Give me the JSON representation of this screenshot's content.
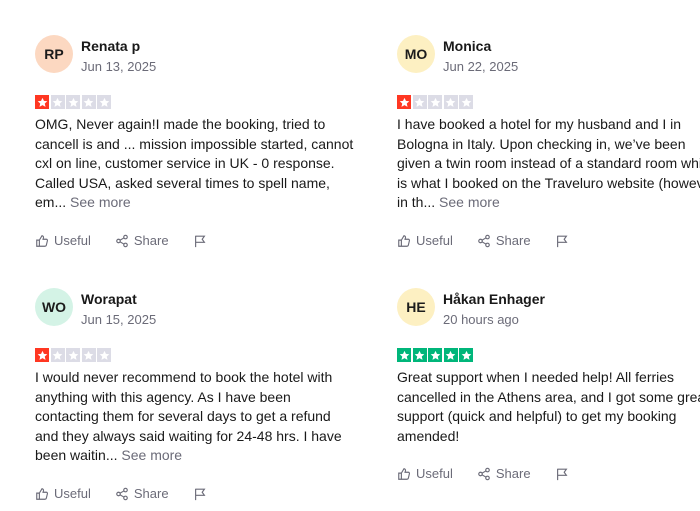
{
  "reviews": [
    {
      "initials": "RP",
      "avatar_color": "#fcd8c1",
      "name": "Renata p",
      "date": "Jun 13, 2025",
      "rating": 1,
      "text": "OMG, Never again!I made the booking, tried to cancell is and ... mission impossible started, cannot cxl on line, customer service in UK - 0 response. Called USA, asked several times to spell name, em...",
      "see_more": "See more"
    },
    {
      "initials": "MO",
      "avatar_color": "#fdf0c2",
      "name": "Monica",
      "date": "Jun 22, 2025",
      "rating": 1,
      "text": "I have booked a hotel for my husband and I in Bologna in Italy. Upon checking in, we’ve been given a twin room instead of a standard room which is what I booked on the Traveluro website (however in th...",
      "see_more": "See more"
    },
    {
      "initials": "WO",
      "avatar_color": "#d4f3e6",
      "name": "Worapat",
      "date": "Jun 15, 2025",
      "rating": 1,
      "text": "I would never recommend to book the hotel with anything with this agency. As I have been contacting them for several days to get a refund and they always said waiting for 24-48 hrs. I have been waitin...",
      "see_more": "See more"
    },
    {
      "initials": "HE",
      "avatar_color": "#fdf0c2",
      "name": "Håkan Enhager",
      "date": "20 hours ago",
      "rating": 5,
      "text": "Great support when I needed help! All ferries cancelled in the Athens area, and I got some great support (quick and helpful) to get my booking amended!",
      "see_more": ""
    }
  ],
  "actions": {
    "useful": "Useful",
    "share": "Share"
  },
  "colors": {
    "star_red": "#ff3722",
    "star_green": "#00b67a",
    "star_empty": "#dcdce6"
  },
  "icons": [
    "thumbs-up-icon",
    "share-icon",
    "flag-icon",
    "star-icon"
  ]
}
